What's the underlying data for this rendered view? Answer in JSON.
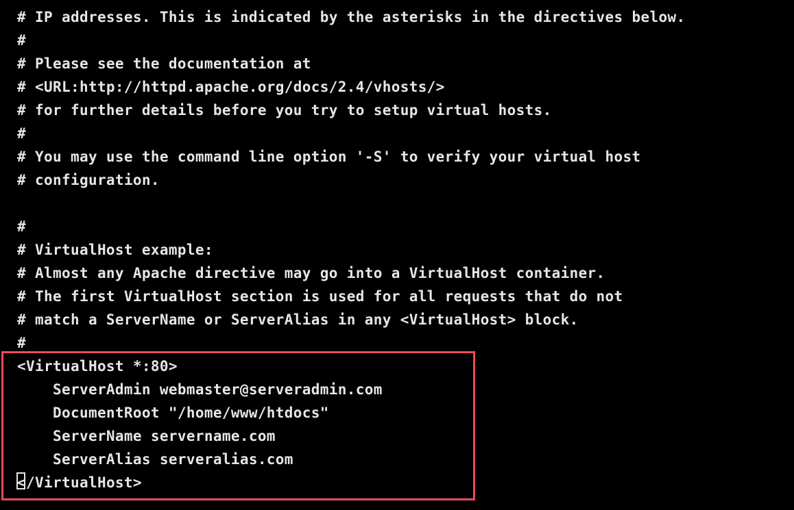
{
  "terminal": {
    "background_color": "#000000",
    "text_color": "#e6e6e6",
    "lines": [
      "# IP addresses. This is indicated by the asterisks in the directives below.",
      "#",
      "# Please see the documentation at",
      "# <URL:http://httpd.apache.org/docs/2.4/vhosts/>",
      "# for further details before you try to setup virtual hosts.",
      "#",
      "# You may use the command line option '-S' to verify your virtual host",
      "# configuration.",
      "",
      "#",
      "# VirtualHost example:",
      "# Almost any Apache directive may go into a VirtualHost container.",
      "# The first VirtualHost section is used for all requests that do not",
      "# match a ServerName or ServerAlias in any <VirtualHost> block.",
      "#"
    ],
    "vhost_block": {
      "open_tag": "<VirtualHost *:80>",
      "directives": [
        "    ServerAdmin webmaster@serveradmin.com",
        "    DocumentRoot \"/home/www/htdocs\"",
        "    ServerName servername.com",
        "    ServerAlias serveralias.com"
      ],
      "close_tag_cursor_char": "<",
      "close_tag_rest": "/VirtualHost>"
    }
  },
  "annotation": {
    "highlight_box_color": "#ef4b58",
    "highlight_box_label": "virtualhost-block-highlight"
  }
}
